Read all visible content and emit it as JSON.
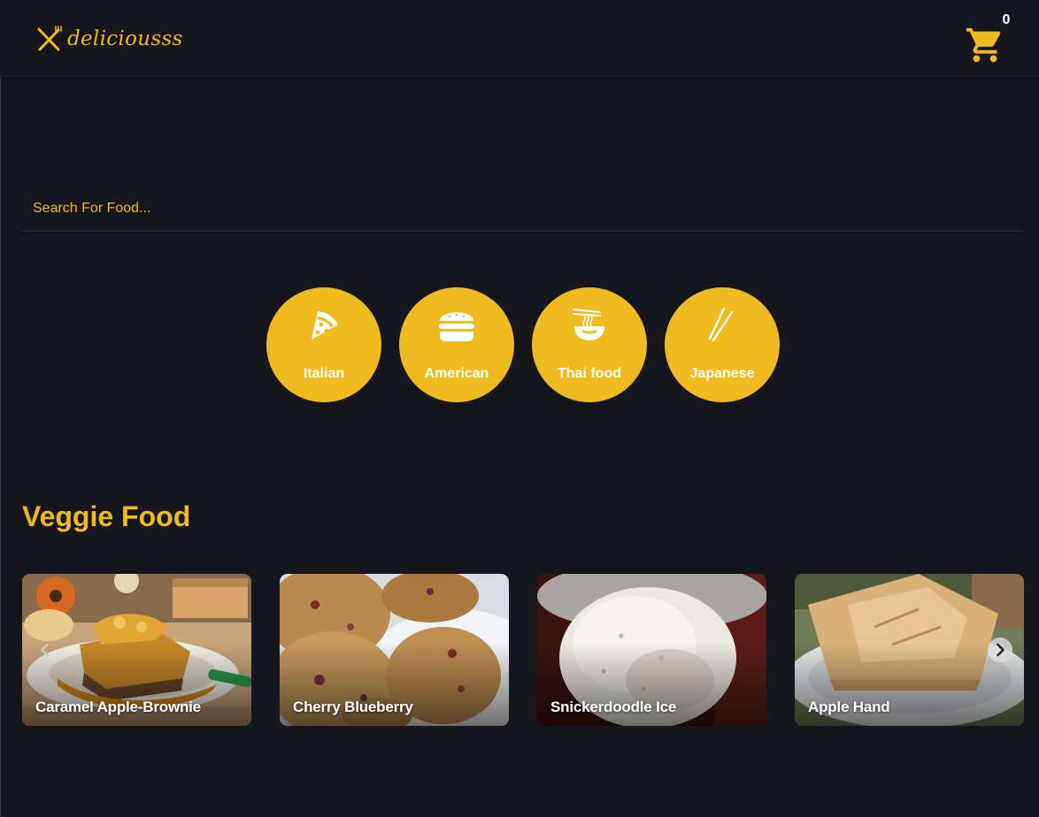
{
  "header": {
    "logo_text": "deliciousss",
    "cart_count": "0",
    "brand_color": "#efbb1f"
  },
  "search": {
    "placeholder": "Search For Food..."
  },
  "categories": [
    {
      "label": "Italian",
      "icon": "pizza-icon"
    },
    {
      "label": "American",
      "icon": "burger-icon"
    },
    {
      "label": "Thai food",
      "icon": "noodle-bowl-icon"
    },
    {
      "label": "Japanese",
      "icon": "chopsticks-icon"
    }
  ],
  "veggie": {
    "title": "Veggie Food",
    "cards": [
      {
        "title": "Caramel Apple-Brownie"
      },
      {
        "title": "Cherry Blueberry"
      },
      {
        "title": "Snickerdoodle Ice"
      },
      {
        "title": "Apple Hand"
      }
    ]
  },
  "carousel": {
    "prev_icon": "chevron-left-icon",
    "next_icon": "chevron-right-icon"
  }
}
